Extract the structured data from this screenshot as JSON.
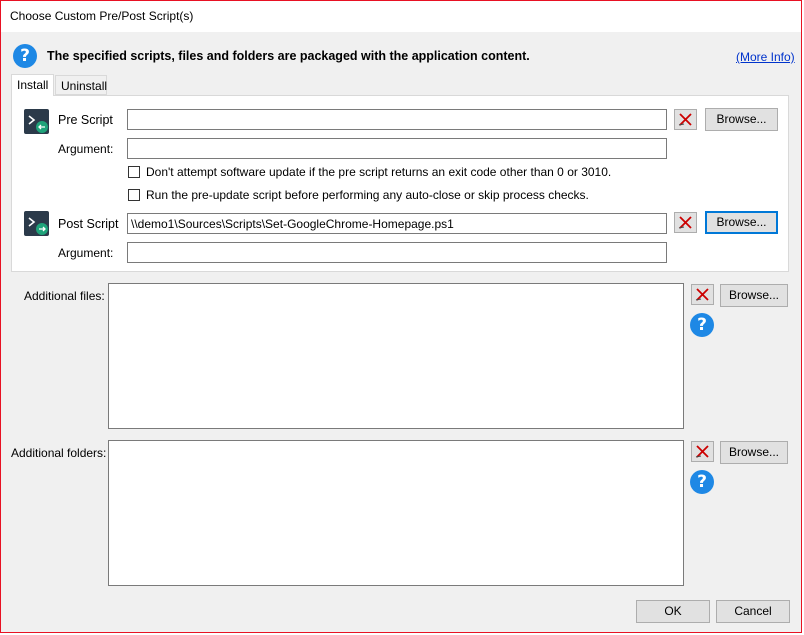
{
  "window": {
    "title": "Choose Custom Pre/Post Script(s)"
  },
  "header": {
    "text": "The specified scripts, files and folders are packaged with the application content.",
    "more_info": "(More Info)",
    "icon": "help-circle-icon"
  },
  "tabs": [
    {
      "label": "Install",
      "active": true
    },
    {
      "label": "Uninstall",
      "active": false
    }
  ],
  "pre_script": {
    "label": "Pre Script",
    "value": "",
    "argument_label": "Argument:",
    "argument_value": "",
    "browse": "Browse...",
    "icon": "powershell-pre-icon",
    "options": [
      {
        "label": "Don't attempt software update if the pre script returns an exit code other than 0 or 3010.",
        "checked": false
      },
      {
        "label": "Run the pre-update script before performing any auto-close or skip process checks.",
        "checked": false
      }
    ]
  },
  "post_script": {
    "label": "Post Script",
    "value": "\\\\demo1\\Sources\\Scripts\\Set-GoogleChrome-Homepage.ps1",
    "argument_label": "Argument:",
    "argument_value": "",
    "browse": "Browse...",
    "icon": "powershell-post-icon"
  },
  "additional_files": {
    "label": "Additional files:",
    "browse": "Browse..."
  },
  "additional_folders": {
    "label": "Additional folders:",
    "browse": "Browse..."
  },
  "footer": {
    "ok": "OK",
    "cancel": "Cancel"
  },
  "colors": {
    "accent": "#0078d7",
    "help_blue": "#1e88e5",
    "window_border": "#e81123",
    "clear_x": "#cc0000"
  }
}
